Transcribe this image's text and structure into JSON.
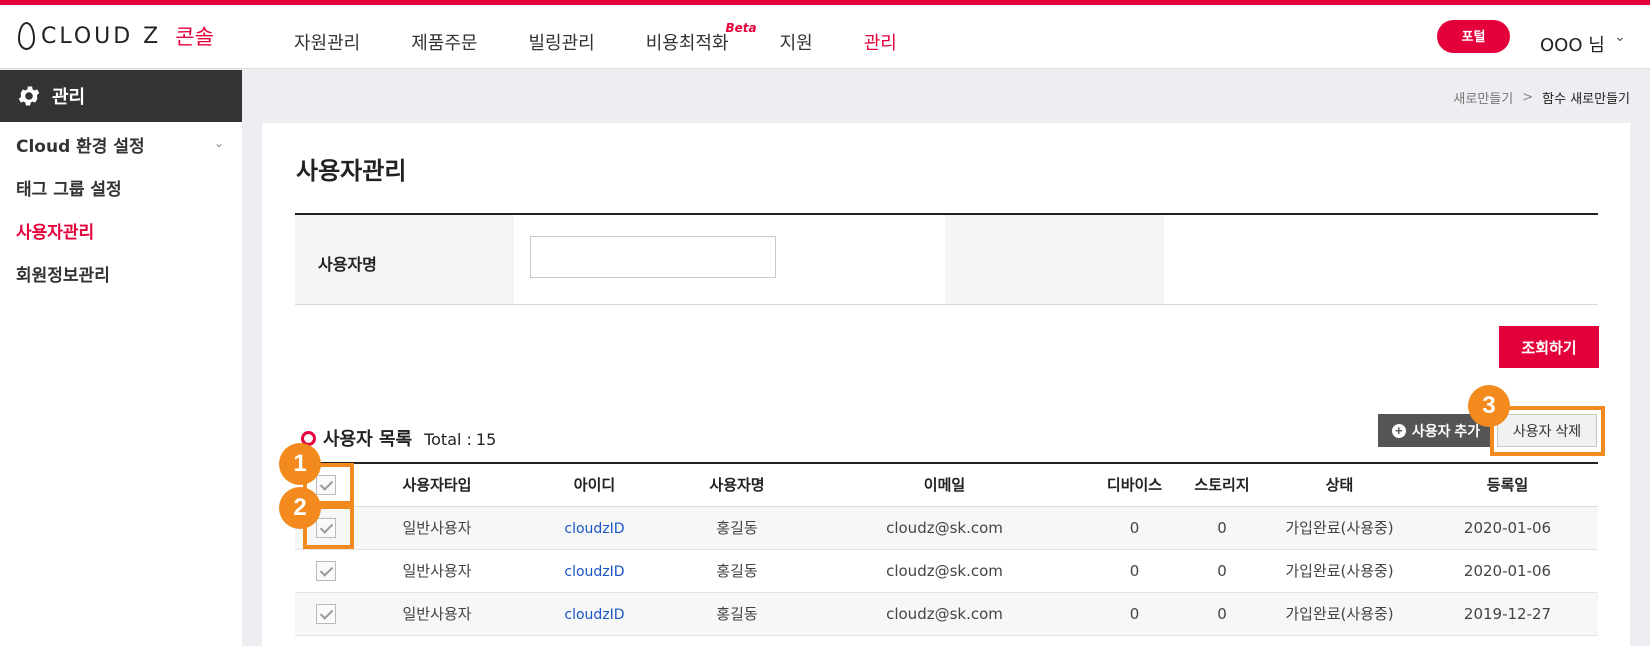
{
  "header": {
    "logo_text": "CLOUD Z",
    "logo_sub": "콘솔",
    "nav": [
      {
        "label": "자원관리"
      },
      {
        "label": "제품주문"
      },
      {
        "label": "빌링관리"
      },
      {
        "label": "비용최적화",
        "badge": "Beta"
      },
      {
        "label": "지원"
      },
      {
        "label": "관리"
      }
    ],
    "portal_label": "포털",
    "user_name": "OOO 님",
    "user_chevron": "⌄"
  },
  "sidebar": {
    "title": "관리",
    "items": [
      {
        "label": "Cloud 환경 설정"
      },
      {
        "label": "태그 그룹 설정"
      },
      {
        "label": "사용자관리"
      },
      {
        "label": "회원정보관리"
      }
    ]
  },
  "breadcrumb": {
    "parent": "새로만들기",
    "separator": ">",
    "current": "함수 새로만들기"
  },
  "main": {
    "title": "사용자관리",
    "filter": {
      "label": "사용자명",
      "value": ""
    },
    "search_label": "조회하기",
    "list_title": "사용자 목록",
    "total_label": "Total :",
    "total_count": "15",
    "add_label": "사용자 추가",
    "delete_label": "사용자 삭제",
    "columns": [
      "사용자타입",
      "아이디",
      "사용자명",
      "이메일",
      "디바이스",
      "스토리지",
      "상태",
      "등록일"
    ],
    "rows": [
      {
        "type": "일반사용자",
        "id": "cloudzID",
        "name": "홍길동",
        "email": "cloudz@sk.com",
        "device": "0",
        "storage": "0",
        "status": "가입완료(사용중)",
        "date": "2020-01-06"
      },
      {
        "type": "일반사용자",
        "id": "cloudzID",
        "name": "홍길동",
        "email": "cloudz@sk.com",
        "device": "0",
        "storage": "0",
        "status": "가입완료(사용중)",
        "date": "2020-01-06"
      },
      {
        "type": "일반사용자",
        "id": "cloudzID",
        "name": "홍길동",
        "email": "cloudz@sk.com",
        "device": "0",
        "storage": "0",
        "status": "가입완료(사용중)",
        "date": "2019-12-27"
      }
    ]
  },
  "annotations": [
    "1",
    "2",
    "3"
  ],
  "colors": {
    "brand": "#e4003a",
    "annotation": "#f28a1e",
    "sidebar_head": "#333333"
  }
}
